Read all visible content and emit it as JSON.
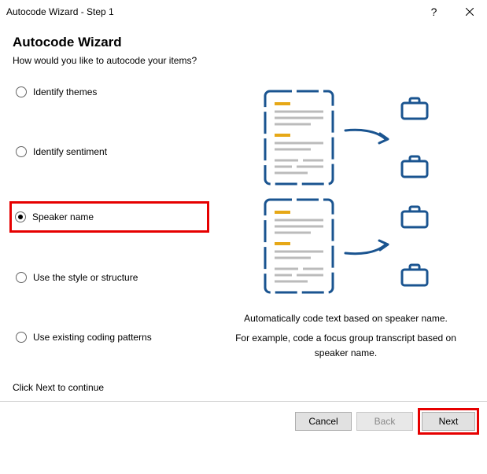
{
  "window": {
    "title": "Autocode Wizard - Step 1"
  },
  "header": {
    "heading": "Autocode Wizard",
    "subheading": "How would you like to autocode your items?"
  },
  "options": {
    "themes": "Identify themes",
    "sentiment": "Identify sentiment",
    "speaker": "Speaker name",
    "style": "Use the style or structure",
    "existing": "Use existing coding patterns",
    "selected": "speaker"
  },
  "description": {
    "line1": "Automatically code text based on speaker name.",
    "line2": "For example, code a focus group transcript based on speaker name."
  },
  "hint": "Click Next to continue",
  "buttons": {
    "cancel": "Cancel",
    "back": "Back",
    "next": "Next"
  }
}
